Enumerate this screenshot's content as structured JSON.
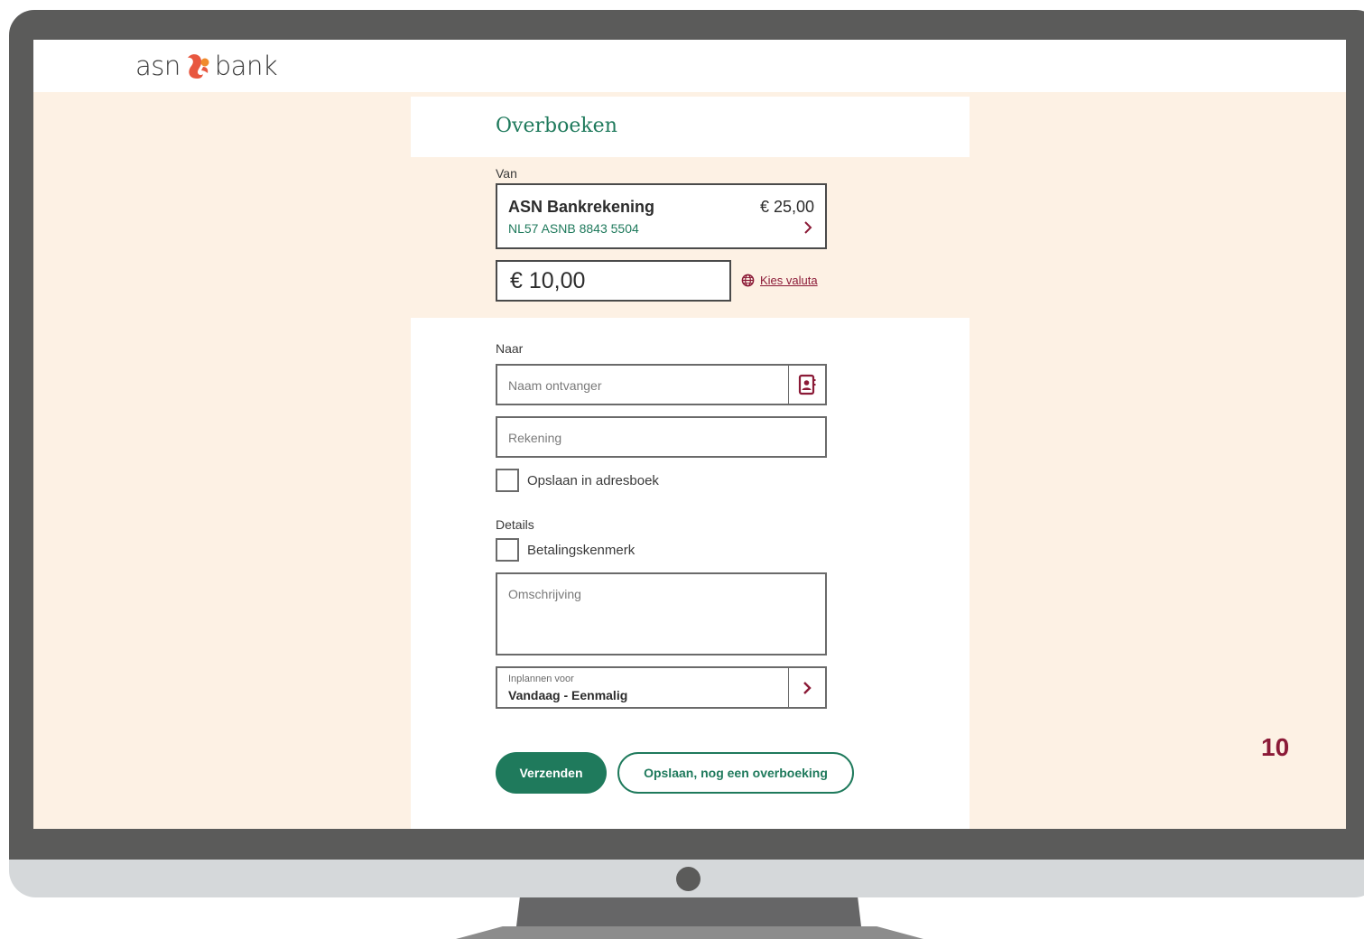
{
  "brand": {
    "logo_left": "asn",
    "logo_right": "bank",
    "accent": "#1f7a5c",
    "secondary": "#8b1a37"
  },
  "page": {
    "title": "Overboeken"
  },
  "from": {
    "label": "Van",
    "account_name": "ASN Bankrekening",
    "iban": "NL57 ASNB 8843 5504",
    "balance": "€ 25,00"
  },
  "amount": {
    "value": "€ 10,00",
    "currency_link": "Kies valuta"
  },
  "to": {
    "label": "Naar",
    "name_placeholder": "Naam ontvanger",
    "account_placeholder": "Rekening",
    "save_label": "Opslaan in adresboek"
  },
  "details": {
    "label": "Details",
    "reference_label": "Betalingskenmerk",
    "description_placeholder": "Omschrijving"
  },
  "schedule": {
    "caption": "Inplannen voor",
    "value": "Vandaag - Eenmalig"
  },
  "actions": {
    "send": "Verzenden",
    "save_another": "Opslaan, nog een overboeking"
  },
  "step": "10"
}
